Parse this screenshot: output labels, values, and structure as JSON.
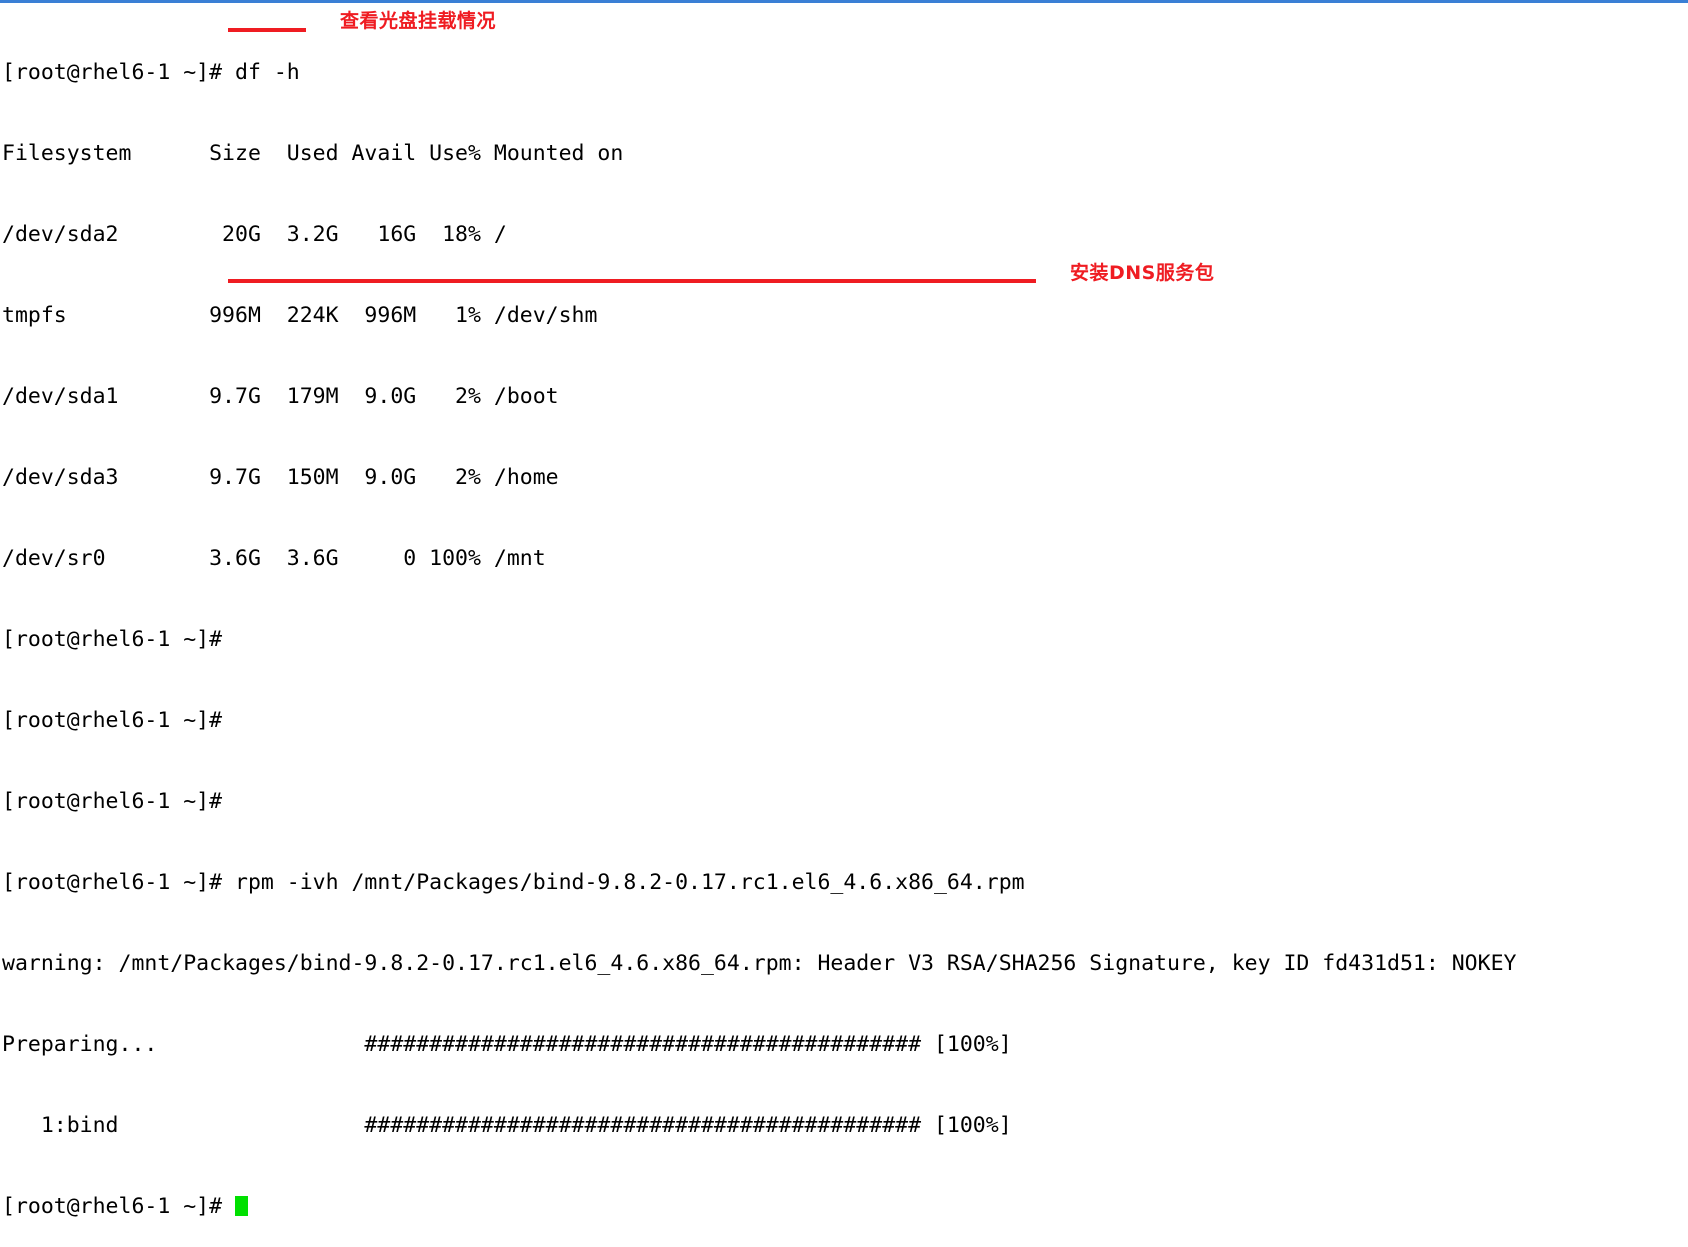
{
  "window": {
    "accent_color": "#3a7fd5",
    "background_color": "#ffffff",
    "foreground_color": "#000000",
    "annotation_color": "#ef1c22",
    "cursor_color": "#00e000"
  },
  "terminal": {
    "prompt": "[root@rhel6-1 ~]#",
    "lines": [
      "[root@rhel6-1 ~]# df -h",
      "Filesystem      Size  Used Avail Use% Mounted on",
      "/dev/sda2        20G  3.2G   16G  18% /",
      "tmpfs           996M  224K  996M   1% /dev/shm",
      "/dev/sda1       9.7G  179M  9.0G   2% /boot",
      "/dev/sda3       9.7G  150M  9.0G   2% /home",
      "/dev/sr0        3.6G  3.6G     0 100% /mnt",
      "[root@rhel6-1 ~]#",
      "[root@rhel6-1 ~]#",
      "[root@rhel6-1 ~]#",
      "[root@rhel6-1 ~]# rpm -ivh /mnt/Packages/bind-9.8.2-0.17.rc1.el6_4.6.x86_64.rpm",
      "warning: /mnt/Packages/bind-9.8.2-0.17.rc1.el6_4.6.x86_64.rpm: Header V3 RSA/SHA256 Signature, key ID fd431d51: NOKEY",
      "Preparing...                ########################################### [100%]",
      "   1:bind                   ########################################### [100%]"
    ],
    "final_prompt": "[root@rhel6-1 ~]# ",
    "commands": {
      "df": "df -h",
      "rpm": "rpm -ivh /mnt/Packages/bind-9.8.2-0.17.rc1.el6_4.6.x86_64.rpm"
    },
    "df_table": {
      "headers": [
        "Filesystem",
        "Size",
        "Used",
        "Avail",
        "Use%",
        "Mounted on"
      ],
      "rows": [
        [
          "/dev/sda2",
          "20G",
          "3.2G",
          "16G",
          "18%",
          "/"
        ],
        [
          "tmpfs",
          "996M",
          "224K",
          "996M",
          "1%",
          "/dev/shm"
        ],
        [
          "/dev/sda1",
          "9.7G",
          "179M",
          "9.0G",
          "2%",
          "/boot"
        ],
        [
          "/dev/sda3",
          "9.7G",
          "150M",
          "9.0G",
          "2%",
          "/home"
        ],
        [
          "/dev/sr0",
          "3.6G",
          "3.6G",
          "0",
          "100%",
          "/mnt"
        ]
      ]
    },
    "install_progress": [
      {
        "label": "Preparing...",
        "bar": "###########################################",
        "percent": "[100%]"
      },
      {
        "label": "   1:bind",
        "bar": "###########################################",
        "percent": "[100%]"
      }
    ]
  },
  "annotations": [
    {
      "id": "disk",
      "text": "查看光盘挂载情况"
    },
    {
      "id": "dns",
      "text": "安装DNS服务包"
    }
  ]
}
